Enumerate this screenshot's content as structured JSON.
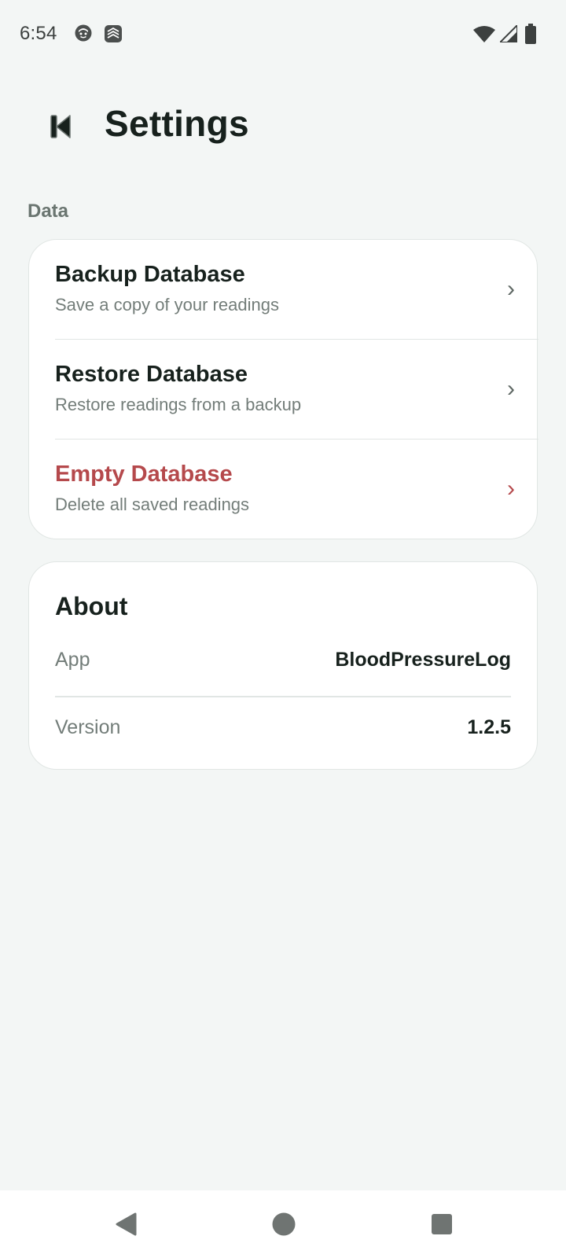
{
  "status_bar": {
    "time": "6:54",
    "left_icons": [
      "face-notification-icon",
      "stack-notification-icon"
    ],
    "right_icons": [
      "wifi-icon",
      "signal-icon",
      "battery-icon"
    ]
  },
  "header": {
    "back_icon": "back-icon",
    "title": "Settings"
  },
  "data_section": {
    "label": "Data",
    "items": [
      {
        "title": "Backup Database",
        "subtitle": "Save a copy of your readings",
        "chevron": "›"
      },
      {
        "title": "Restore Database",
        "subtitle": "Restore readings from a backup",
        "chevron": "›"
      },
      {
        "title": "Empty Database",
        "subtitle": "Delete all saved readings",
        "chevron": "›"
      }
    ]
  },
  "about": {
    "title": "About",
    "rows": [
      {
        "label": "App",
        "value": "BloodPressureLog"
      },
      {
        "label": "Version",
        "value": "1.2.5"
      }
    ]
  },
  "nav_bar": {
    "buttons": [
      "back-triangle-icon",
      "home-circle-icon",
      "recents-square-icon"
    ]
  },
  "colors": {
    "background": "#f3f6f5",
    "card": "#ffffff",
    "text_primary": "#17211d",
    "text_secondary": "#737d79",
    "danger": "#b5494c",
    "section_label": "#6a7570"
  }
}
